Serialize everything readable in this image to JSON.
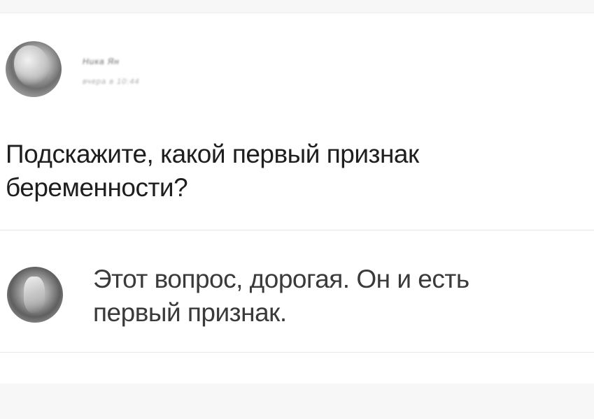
{
  "post": {
    "author": {
      "name": "Ника Ян",
      "date": "вчера в 10:44"
    },
    "text_line_1": "Подскажите, какой первый признак",
    "text_line_2": "беременности?"
  },
  "comment": {
    "text_line_1": "Этот вопрос, дорогая. Он и есть",
    "text_line_2": "первый признак."
  }
}
